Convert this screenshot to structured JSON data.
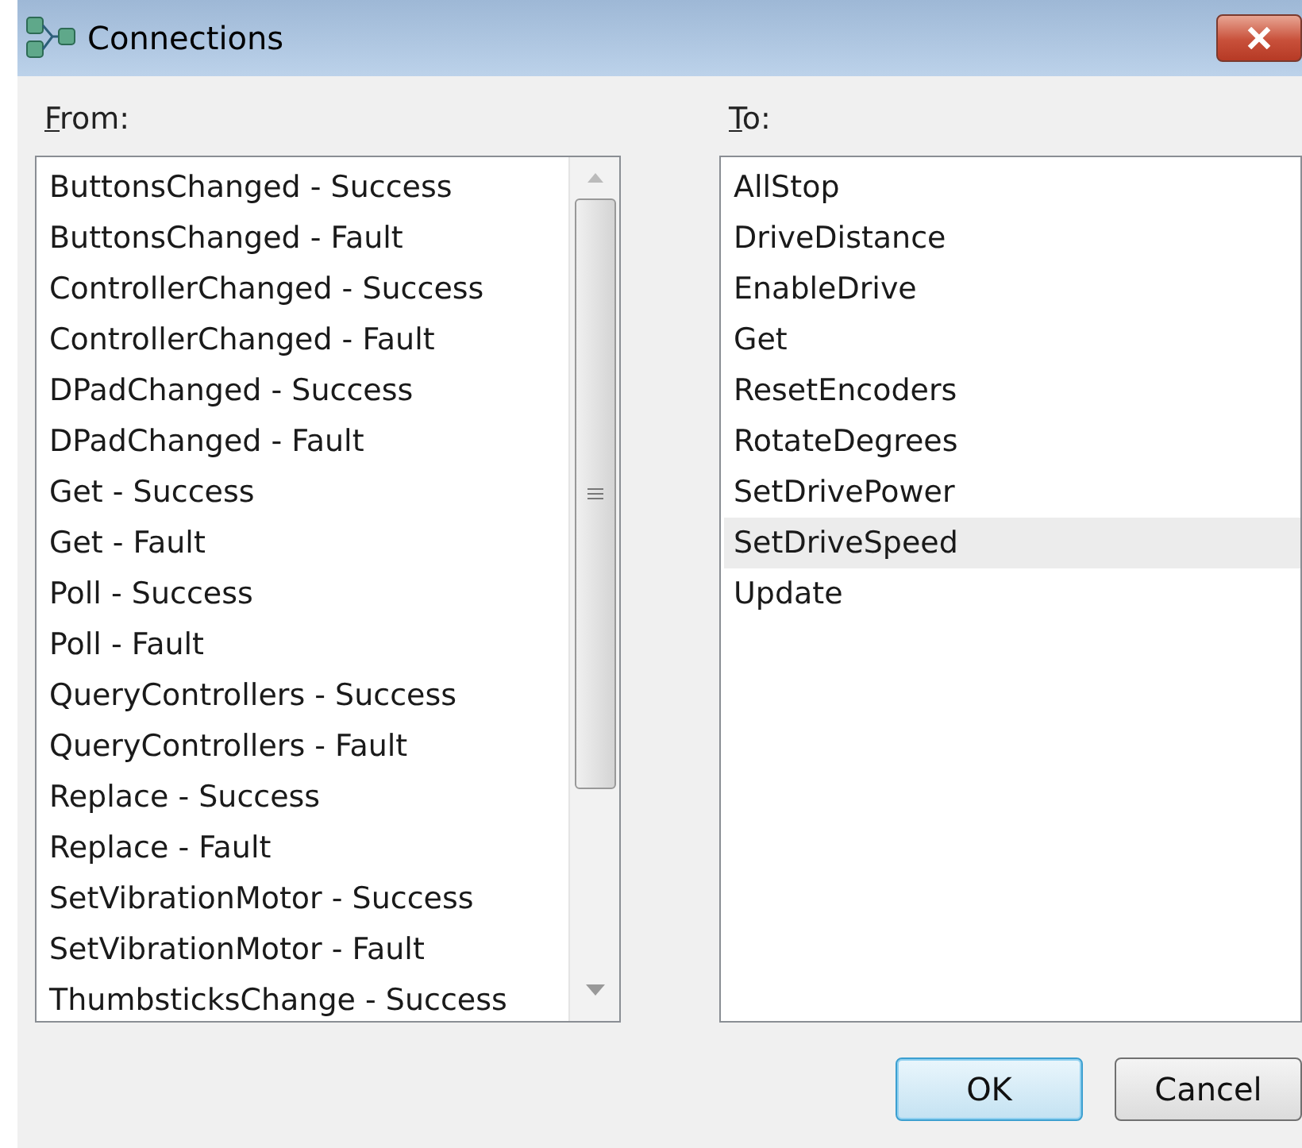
{
  "window": {
    "title": "Connections"
  },
  "from": {
    "label": "From:",
    "underline_first": true,
    "items": [
      {
        "text": "ButtonsChanged - Success",
        "selected": false
      },
      {
        "text": "ButtonsChanged - Fault",
        "selected": false
      },
      {
        "text": "ControllerChanged - Success",
        "selected": false
      },
      {
        "text": "ControllerChanged - Fault",
        "selected": false
      },
      {
        "text": "DPadChanged - Success",
        "selected": false
      },
      {
        "text": "DPadChanged - Fault",
        "selected": false
      },
      {
        "text": "Get - Success",
        "selected": false
      },
      {
        "text": "Get - Fault",
        "selected": false
      },
      {
        "text": "Poll - Success",
        "selected": false
      },
      {
        "text": "Poll - Fault",
        "selected": false
      },
      {
        "text": "QueryControllers - Success",
        "selected": false
      },
      {
        "text": "QueryControllers - Fault",
        "selected": false
      },
      {
        "text": "Replace - Success",
        "selected": false
      },
      {
        "text": "Replace - Fault",
        "selected": false
      },
      {
        "text": "SetVibrationMotor - Success",
        "selected": false
      },
      {
        "text": "SetVibrationMotor - Fault",
        "selected": false
      },
      {
        "text": "ThumbsticksChange - Success",
        "selected": false
      }
    ]
  },
  "to": {
    "label": "To:",
    "underline_first": true,
    "items": [
      {
        "text": "AllStop",
        "selected": false
      },
      {
        "text": "DriveDistance",
        "selected": false
      },
      {
        "text": "EnableDrive",
        "selected": false
      },
      {
        "text": "Get",
        "selected": false
      },
      {
        "text": "ResetEncoders",
        "selected": false
      },
      {
        "text": "RotateDegrees",
        "selected": false
      },
      {
        "text": "SetDrivePower",
        "selected": false
      },
      {
        "text": "SetDriveSpeed",
        "selected": true
      },
      {
        "text": "Update",
        "selected": false
      }
    ]
  },
  "buttons": [
    {
      "label": "OK",
      "default": true
    },
    {
      "label": "Cancel",
      "default": false
    }
  ]
}
